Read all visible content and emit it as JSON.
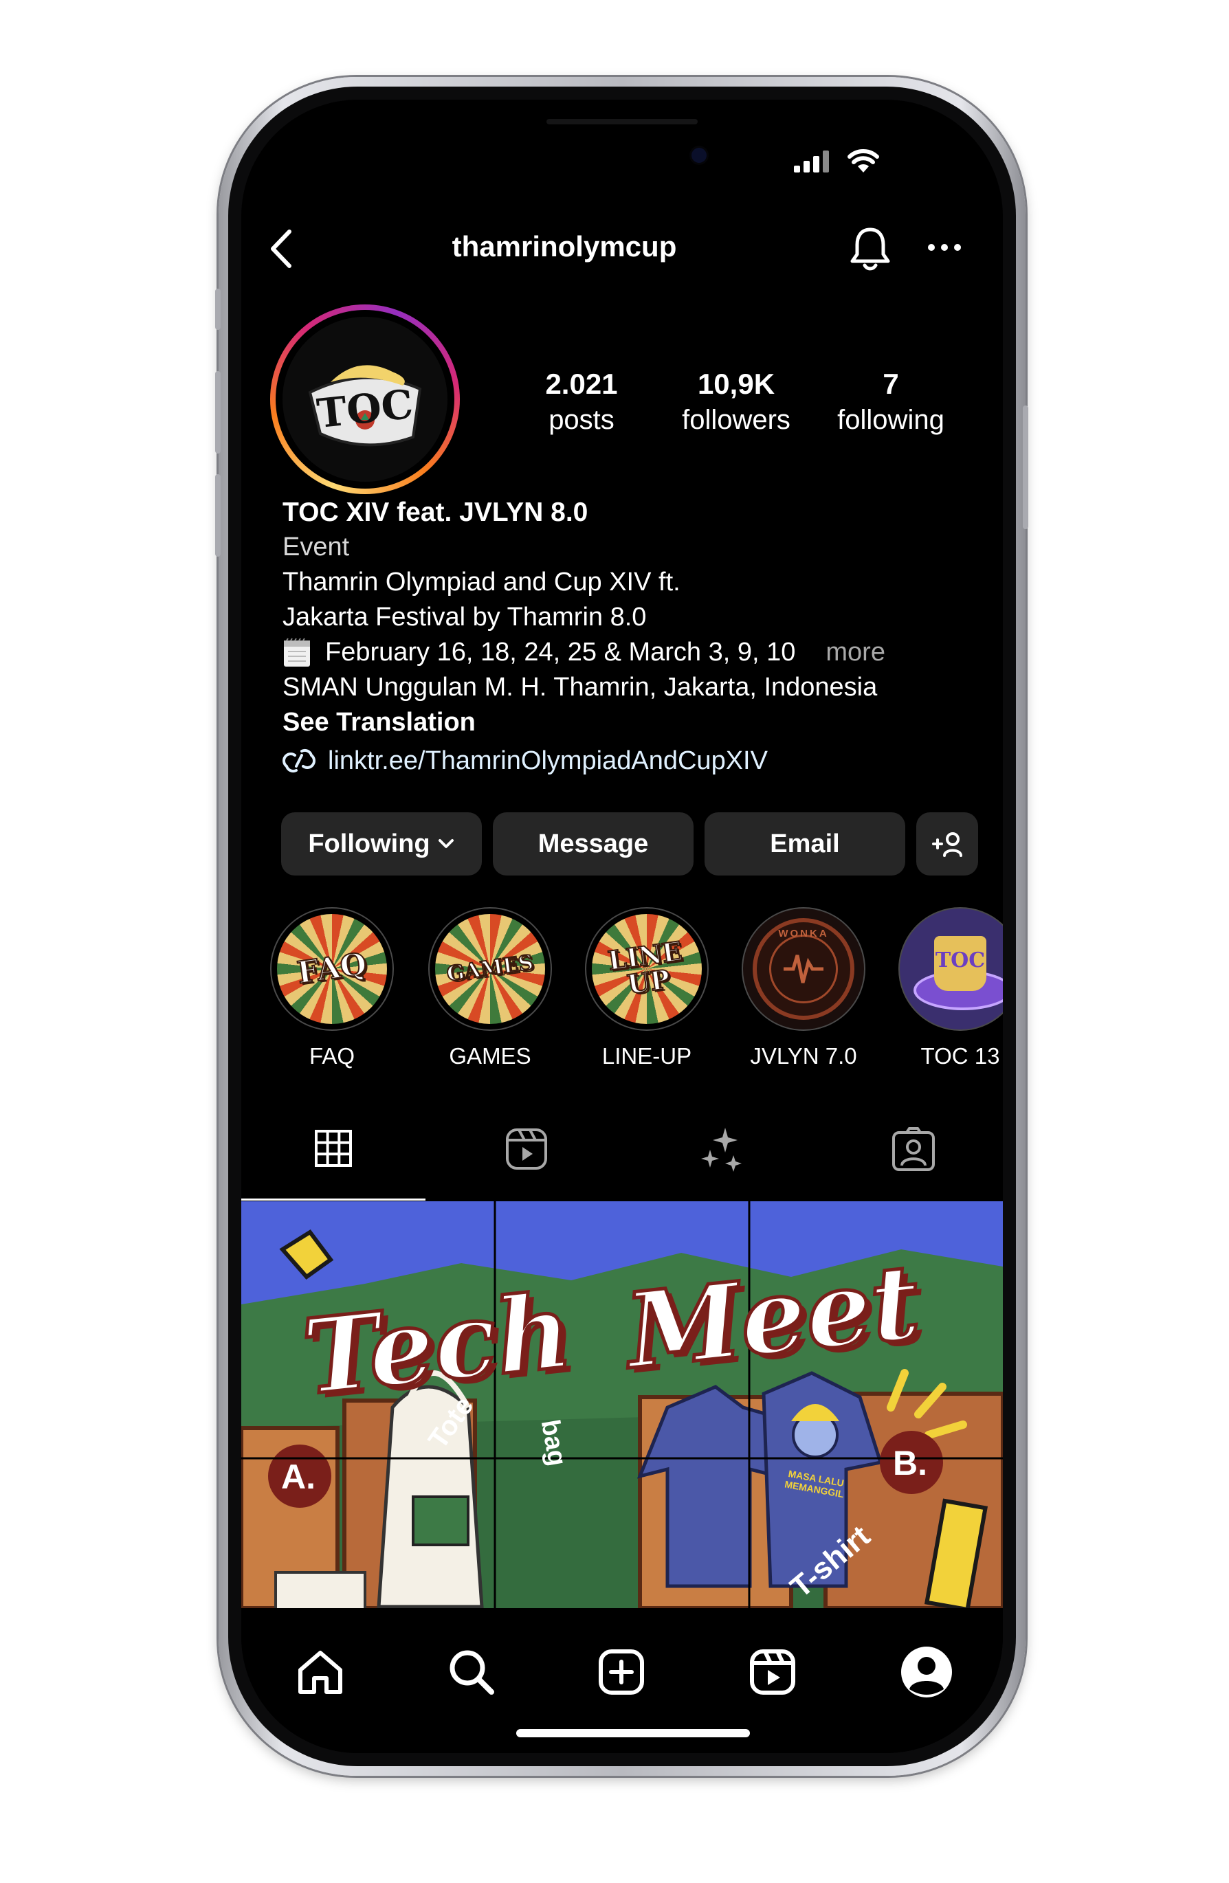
{
  "header": {
    "username": "thamrinolymcup"
  },
  "profile": {
    "avatar_text": "TOC",
    "stats": [
      {
        "value": "2.021",
        "label": "posts"
      },
      {
        "value": "10,9K",
        "label": "followers"
      },
      {
        "value": "7",
        "label": "following"
      }
    ],
    "name": "TOC XIV feat. JVLYN 8.0",
    "category": "Event",
    "bio_line1": "Thamrin Olympiad and Cup XIV ft.",
    "bio_line2": "Jakarta Festival by Thamrin 8.0",
    "bio_line3": "February 16, 18, 24, 25 & March 3, 9, 10",
    "bio_more": "more",
    "bio_line4": "SMAN Unggulan M. H. Thamrin, Jakarta, Indonesia",
    "see_translation": "See Translation",
    "link": "linktr.ee/ThamrinOlympiadAndCupXIV"
  },
  "actions": {
    "following": "Following",
    "message": "Message",
    "email": "Email"
  },
  "highlights": [
    {
      "label": "FAQ",
      "art_text": "FAQ"
    },
    {
      "label": "GAMES",
      "art_text": "GAMES"
    },
    {
      "label": "LINE-UP",
      "art_text": "LINE UP"
    },
    {
      "label": "JVLYN 7.0",
      "art_text": "WONKA"
    },
    {
      "label": "TOC 13",
      "art_text": "TOC"
    }
  ],
  "tabs": [
    "grid-icon",
    "reels-icon",
    "sparkles-icon",
    "tagged-icon"
  ],
  "post": {
    "title_word1": "Tech",
    "title_word2": "Meet",
    "marker_a": "A.",
    "marker_b": "B.",
    "tote_label": "Tote",
    "bag_label": "bag",
    "tshirt_label": "T-shirt",
    "shirt_caption": "MASA LALU MEMANGGIL"
  },
  "bottom_nav": [
    "home-icon",
    "search-icon",
    "create-icon",
    "reels-icon",
    "profile-icon"
  ],
  "colors": {
    "background": "#000000",
    "pill": "#262626",
    "post_blue": "#4a5fd6",
    "post_green": "#3d7a46",
    "post_maroon": "#7a1f1a"
  }
}
